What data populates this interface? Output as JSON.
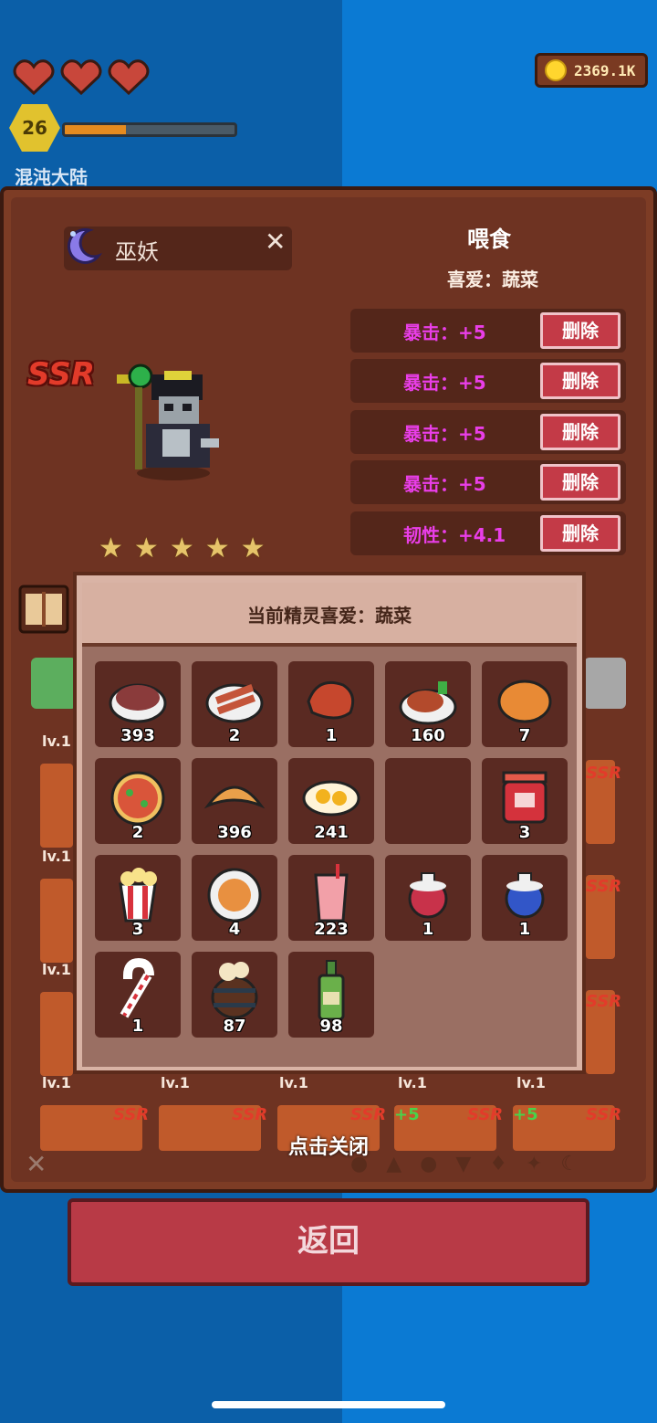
{
  "hud": {
    "hearts": 3,
    "coins": "2369.1K",
    "level": "26",
    "xp_progress": 0.36,
    "world": "混沌大陆"
  },
  "monster": {
    "name": "巫妖",
    "close_symbol": "✕",
    "rarity": "SSR",
    "stars": [
      "★",
      "★",
      "★",
      "★",
      "★"
    ]
  },
  "feed": {
    "title": "喂食",
    "favorite_line": "喜爱：蔬菜",
    "stats": [
      {
        "text": "暴击：+5",
        "button": "删除"
      },
      {
        "text": "暴击：+5",
        "button": "删除"
      },
      {
        "text": "暴击：+5",
        "button": "删除"
      },
      {
        "text": "暴击：+5",
        "button": "删除"
      },
      {
        "text": "韧性：+4.1",
        "button": "删除"
      }
    ]
  },
  "popup": {
    "title": "当前精灵喜爱：蔬菜",
    "items": [
      {
        "icon": "steak-plate-icon",
        "count": "393"
      },
      {
        "icon": "bacon-plate-icon",
        "count": "2"
      },
      {
        "icon": "grilled-meat-icon",
        "count": "1"
      },
      {
        "icon": "meat-dish-icon",
        "count": "160"
      },
      {
        "icon": "bread-icon",
        "count": "7"
      },
      {
        "icon": "pizza-icon",
        "count": "2"
      },
      {
        "icon": "croissant-icon",
        "count": "396"
      },
      {
        "icon": "fried-egg-icon",
        "count": "241"
      },
      {
        "icon": "empty-slot",
        "count": ""
      },
      {
        "icon": "jam-jar-icon",
        "count": "3"
      },
      {
        "icon": "popcorn-icon",
        "count": "3"
      },
      {
        "icon": "soup-bowl-icon",
        "count": "4"
      },
      {
        "icon": "drink-cup-icon",
        "count": "223"
      },
      {
        "icon": "red-potion-icon",
        "count": "1"
      },
      {
        "icon": "blue-potion-icon",
        "count": "1"
      },
      {
        "icon": "candy-cane-icon",
        "count": "1"
      },
      {
        "icon": "beer-barrel-icon",
        "count": "87"
      },
      {
        "icon": "wine-bottle-icon",
        "count": "98"
      }
    ]
  },
  "background": {
    "lv_label": "lv.1",
    "ssr": "SSR",
    "plus": "+5",
    "close_hint": "点击关闭",
    "bottom_close": "✕"
  },
  "back_button": "返回"
}
